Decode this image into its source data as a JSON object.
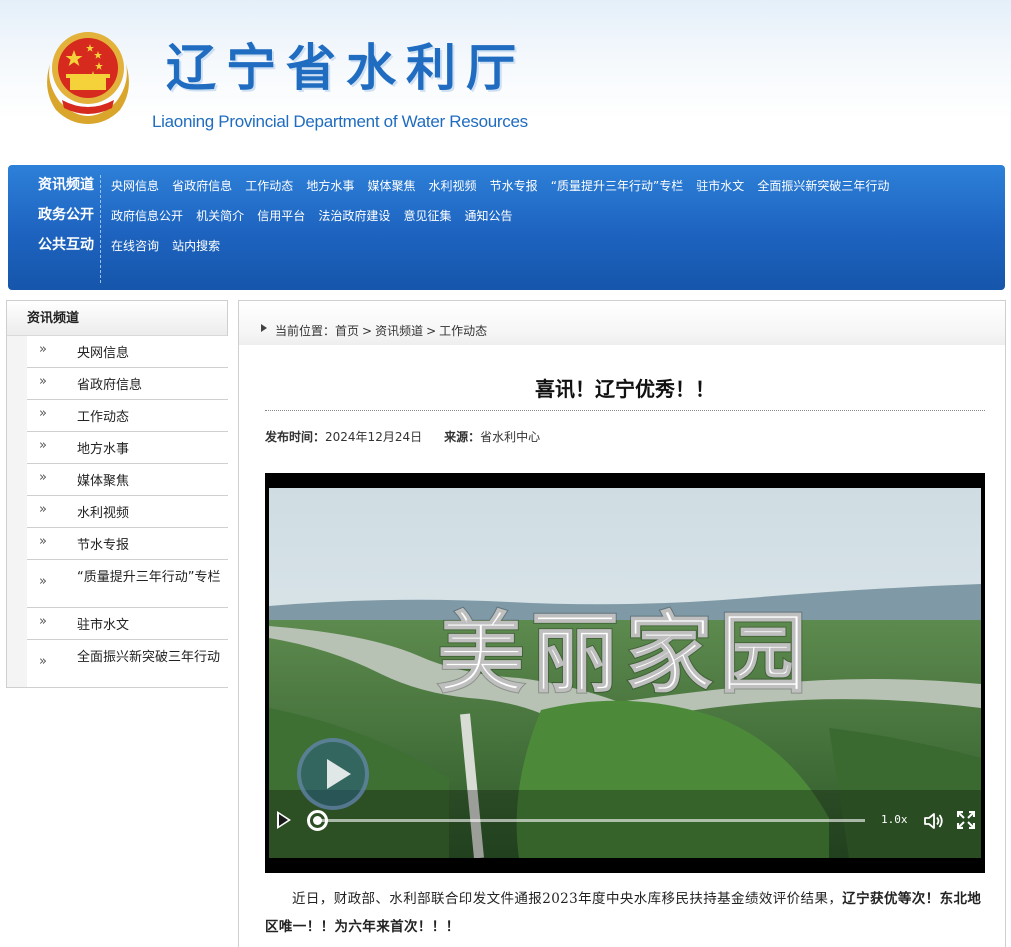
{
  "header": {
    "title": "辽宁省水利厅",
    "subtitle": "Liaoning Provincial Department of Water Resources"
  },
  "nav": {
    "categories": [
      "资讯频道",
      "政务公开",
      "公共互动"
    ],
    "rows": [
      [
        "央网信息",
        "省政府信息",
        "工作动态",
        "地方水事",
        "媒体聚焦",
        "水利视频",
        "节水专报",
        "“质量提升三年行动”专栏",
        "驻市水文",
        "全面振兴新突破三年行动"
      ],
      [
        "政府信息公开",
        "机关简介",
        "信用平台",
        "法治政府建设",
        "意见征集",
        "通知公告"
      ],
      [
        "在线咨询",
        "站内搜索"
      ]
    ]
  },
  "sidebar": {
    "heading": "资讯频道",
    "arrow": "»",
    "items": [
      {
        "label": "央网信息"
      },
      {
        "label": "省政府信息"
      },
      {
        "label": "工作动态"
      },
      {
        "label": "地方水事"
      },
      {
        "label": "媒体聚焦"
      },
      {
        "label": "水利视频"
      },
      {
        "label": "节水专报"
      },
      {
        "label": "“质量提升三年行动”专栏"
      },
      {
        "label": "驻市水文"
      },
      {
        "label": "全面振兴新突破三年行动"
      }
    ]
  },
  "breadcrumb": {
    "prefix": "当前位置：",
    "home": "首页",
    "channel": "资讯频道",
    "current": "工作动态",
    "separator": ">"
  },
  "article": {
    "title": "喜讯！辽宁优秀！！",
    "publish_label": "发布时间：",
    "publish_date": "2024年12月24日",
    "source_label": "来源：",
    "source": "省水利中心",
    "body_normal": "近日，财政部、水利部联合印发文件通报2023年度中央水库移民扶持基金绩效评价结果，",
    "body_bold": "辽宁获优等次！东北地区唯一！！为六年来首次！！！"
  },
  "video": {
    "overlay_text": "美丽家园",
    "speed": "1.0x",
    "progress": 0
  },
  "colors": {
    "brand_blue": "#1f6cc0",
    "nav_blue": "#1d63bf"
  },
  "icons": {
    "emblem": "national-emblem",
    "play": "play-icon",
    "volume": "volume-icon",
    "fullscreen": "fullscreen-icon"
  }
}
